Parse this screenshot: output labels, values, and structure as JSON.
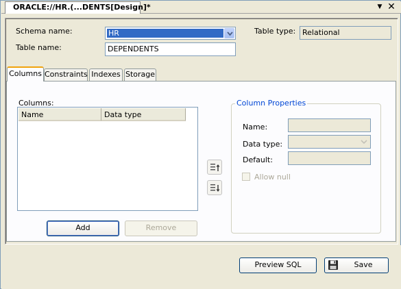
{
  "window": {
    "tab_title": "ORACLE://HR.(...DENTS[Design]*",
    "dropdown_glyph": "▼",
    "close_glyph": "✕"
  },
  "form": {
    "schema_label": "Schema name:",
    "schema_value": "HR",
    "table_name_label": "Table name:",
    "table_name_value": "DEPENDENTS",
    "table_type_label": "Table type:",
    "table_type_value": "Relational"
  },
  "tabs": [
    {
      "label": "Columns",
      "active": true
    },
    {
      "label": "Constraints",
      "active": false
    },
    {
      "label": "Indexes",
      "active": false
    },
    {
      "label": "Storage",
      "active": false
    }
  ],
  "columns": {
    "section_label": "Columns:",
    "headers": [
      "Name",
      "Data type"
    ],
    "rows": [],
    "add_label": "Add",
    "remove_label": "Remove"
  },
  "column_properties": {
    "title": "Column Properties",
    "name_label": "Name:",
    "data_type_label": "Data type:",
    "default_label": "Default:",
    "allow_null_label": "Allow null"
  },
  "footer": {
    "preview_sql_label": "Preview SQL",
    "save_label": "Save"
  },
  "colors": {
    "selection": "#316ac5",
    "active_tab_accent": "#f1a20c",
    "group_title": "#0046d5",
    "window_bg": "#ece9d8"
  }
}
